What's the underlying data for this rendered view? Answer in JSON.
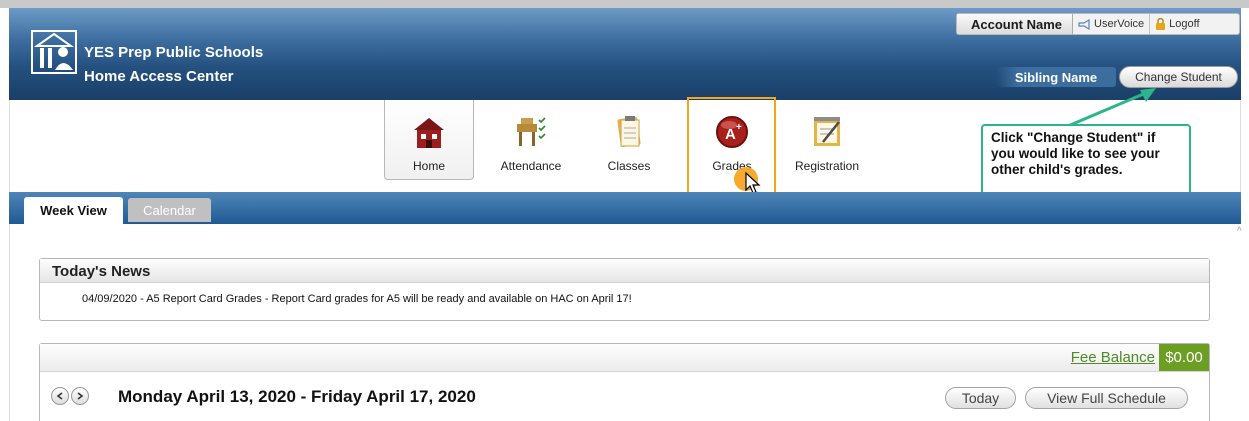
{
  "header": {
    "school_name": "YES Prep Public Schools",
    "app_name": "Home Access Center",
    "account_name": "Account Name",
    "uservoice_label": "UserVoice",
    "logoff_label": "Logoff",
    "sibling_name": "Sibling Name",
    "change_student_label": "Change Student"
  },
  "nav": {
    "items": [
      {
        "label": "Home",
        "icon": "home-icon"
      },
      {
        "label": "Attendance",
        "icon": "attendance-icon"
      },
      {
        "label": "Classes",
        "icon": "classes-icon"
      },
      {
        "label": "Grades",
        "icon": "grades-icon"
      },
      {
        "label": "Registration",
        "icon": "registration-icon"
      }
    ]
  },
  "callout": {
    "text": "Click \"Change Student\" if you would like to see your other child's grades."
  },
  "tabs": {
    "active": "Week View",
    "inactive": "Calendar"
  },
  "news": {
    "title": "Today's News",
    "items": [
      "04/09/2020 - A5 Report Card Grades - Report Card grades for A5 will be ready and available on HAC on April 17!"
    ]
  },
  "schedule": {
    "fee_label": "Fee Balance",
    "fee_value": "$0.00",
    "range": "Monday April 13, 2020 - Friday April 17, 2020",
    "today_label": "Today",
    "full_schedule_label": "View Full Schedule"
  },
  "colors": {
    "header_blue": "#24507f",
    "highlight": "#f0a81a",
    "callout_border": "#2bb58a",
    "fee_green": "#6b9e22"
  }
}
